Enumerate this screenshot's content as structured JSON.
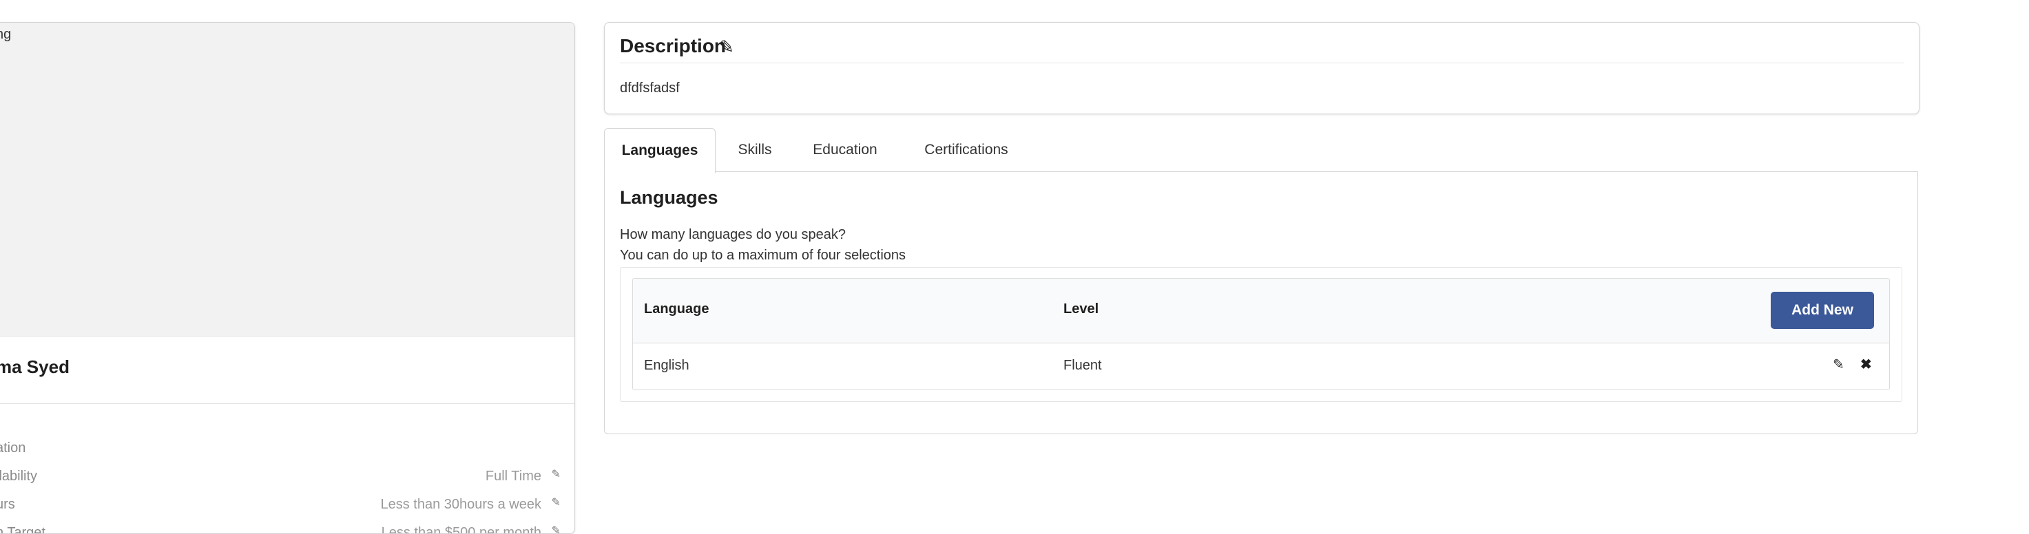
{
  "profile": {
    "photo_alt_fragment": "ng",
    "name_fragment": "ma Syed",
    "rows": [
      {
        "label": "ation",
        "value": "",
        "editable": false
      },
      {
        "label": "ilability",
        "value": "Full Time",
        "editable": true,
        "edit_icon": "pencil-icon"
      },
      {
        "label": "urs",
        "value": "Less than 30hours a week",
        "editable": true,
        "edit_icon": "pencil-icon"
      },
      {
        "label": "n Target",
        "value": "Less than $500 per month",
        "editable": true,
        "edit_icon": "pencil-icon"
      }
    ]
  },
  "description": {
    "title": "Description",
    "edit_icon": "pencil-icon",
    "text": "dfdfsfadsf"
  },
  "tabs": [
    {
      "label": "Languages",
      "active": true
    },
    {
      "label": "Skills",
      "active": false
    },
    {
      "label": "Education",
      "active": false
    },
    {
      "label": "Certifications",
      "active": false
    }
  ],
  "languages": {
    "title": "Languages",
    "question": "How many languages do you speak?",
    "hint": "You can do up to a maximum of four selections",
    "columns": {
      "language": "Language",
      "level": "Level"
    },
    "add_button": "Add New",
    "rows": [
      {
        "language": "English",
        "level": "Fluent",
        "edit_icon": "pencil-icon",
        "delete_icon": "close-icon"
      }
    ]
  },
  "colors": {
    "accent_button": "#3b5998",
    "photo_placeholder": "#f2f2f2"
  }
}
